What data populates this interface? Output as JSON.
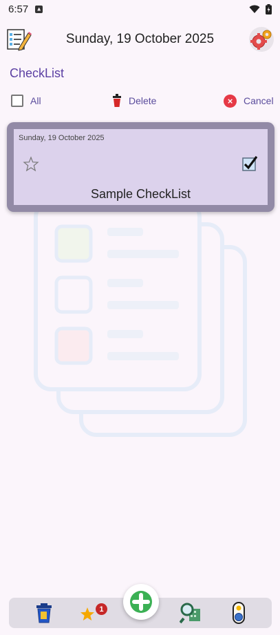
{
  "status_bar": {
    "time": "6:57"
  },
  "header": {
    "date_title": "Sunday, 19 October 2025"
  },
  "section": {
    "title": "CheckList"
  },
  "actions": {
    "all_label": "All",
    "delete_label": "Delete",
    "cancel_label": "Cancel"
  },
  "items": [
    {
      "date": "Sunday, 19 October 2025",
      "title": "Sample CheckList",
      "starred": false,
      "selected": true
    }
  ],
  "bottom_nav": {
    "icons": [
      "trash-icon",
      "star-icon",
      "add-icon",
      "search-icon",
      "toggle-icon"
    ],
    "star_badge": "1"
  },
  "colors": {
    "accent": "#5b3fa3",
    "card_bg": "#dcd2ec",
    "card_border": "#928aa6",
    "fab": "#2e9e4a",
    "cancel": "#e63946"
  }
}
